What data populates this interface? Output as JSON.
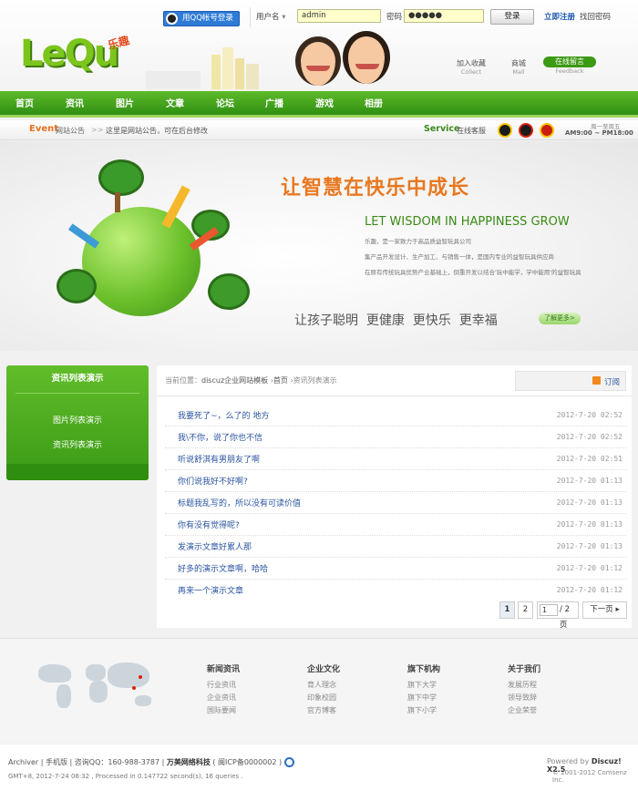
{
  "topbar": {
    "qq_login_label": "用QQ帐号登录",
    "username_select_label": "用户名",
    "username_value": "admin",
    "password_label": "密码",
    "password_value": "●●●●●",
    "login_button": "登录",
    "register_link": "立即注册",
    "forgot_link": "找回密码"
  },
  "logo": {
    "text": "LeQu",
    "cn": "乐趣"
  },
  "header_links": [
    {
      "label": "加入收藏",
      "sub": "Collect"
    },
    {
      "label": "商城",
      "sub": "Mall"
    },
    {
      "label": "在线留言",
      "sub": "Feedback"
    }
  ],
  "nav": [
    "首页",
    "资讯",
    "图片",
    "文章",
    "论坛",
    "广播",
    "游戏",
    "相册"
  ],
  "notice": {
    "event_label": "Event",
    "event_sub": "网站公告",
    "arrows": ">>",
    "text": "这里是网站公告，可在后台修改",
    "service_label": "Service",
    "service_sub": "在线客服",
    "hours_days": "周一至周五",
    "hours_time": "AM9:00 ~ PM18:00"
  },
  "banner": {
    "headline": "让智慧在快乐中成长",
    "headline_en": "LET WISDOM IN HAPPINESS GROW",
    "lines": [
      "乐趣，是一家致力于高品质益智玩具公司",
      "集产品开发设计、生产加工、与销售一体，是国内专业的益智玩具供应商",
      "在原有传统玩具优势产业基础上，倒重开发以结合'玩中能学，学中能用'的益智玩具"
    ],
    "slogan": "让孩子聪明  更健康  更快乐  更幸福",
    "more_button": "了解更多>"
  },
  "sidebar": {
    "title": "资讯列表演示",
    "items": [
      "图片列表演示",
      "资讯列表演示"
    ]
  },
  "breadcrumb": {
    "prefix": "当前位置：",
    "site": "discuz企业网站模板",
    "sep1": "›",
    "home": "首页",
    "sep2": "›",
    "current": "资讯列表演示"
  },
  "subscribe_label": "订阅",
  "articles": [
    {
      "title": "我要死了~，么了的  地方",
      "date": "2012-7-20 02:52"
    },
    {
      "title": "我\\不你，说了你也不信",
      "date": "2012-7-20 02:52"
    },
    {
      "title": "听说舒淇有男朋友了啊",
      "date": "2012-7-20 02:51"
    },
    {
      "title": "你们说我好不好啊?",
      "date": "2012-7-20 01:13"
    },
    {
      "title": "标题我乱写的，所以没有可读价值",
      "date": "2012-7-20 01:13"
    },
    {
      "title": "你有没有觉得呢?",
      "date": "2012-7-20 01:13"
    },
    {
      "title": "发演示文章好累人那",
      "date": "2012-7-20 01:13"
    },
    {
      "title": "好多的演示文章啊，哈哈",
      "date": "2012-7-20 01:12"
    },
    {
      "title": "再来一个演示文章",
      "date": "2012-7-20 01:12"
    }
  ],
  "pagination": {
    "pages": [
      "1",
      "2"
    ],
    "current_input": "1",
    "total": "/ 2 页",
    "next": "下一页"
  },
  "footer_columns": [
    {
      "title": "新闻资讯",
      "links": [
        "行业资讯",
        "企业资讯",
        "国际要闻"
      ]
    },
    {
      "title": "企业文化",
      "links": [
        "育人理念",
        "印象校园",
        "官方博客"
      ]
    },
    {
      "title": "旗下机构",
      "links": [
        "旗下大学",
        "旗下中学",
        "旗下小学"
      ]
    },
    {
      "title": "关于我们",
      "links": [
        "发展历程",
        "领导致辞",
        "企业荣誉"
      ]
    }
  ],
  "bottom": {
    "archiver": "Archiver",
    "mobile": "手机版",
    "qq": "咨询QQ：160-988-3787",
    "company": "万美网络科技",
    "icp": "( 闽ICP备0000002 )",
    "gmt": "GMT+8, 2012-7-24 08:32 , Processed in 0.147722 second(s), 16 queries .",
    "powered": "Powered by",
    "discuz": "Discuz! X2.5",
    "copyright": "© 2001-2012 Comsenz Inc."
  }
}
